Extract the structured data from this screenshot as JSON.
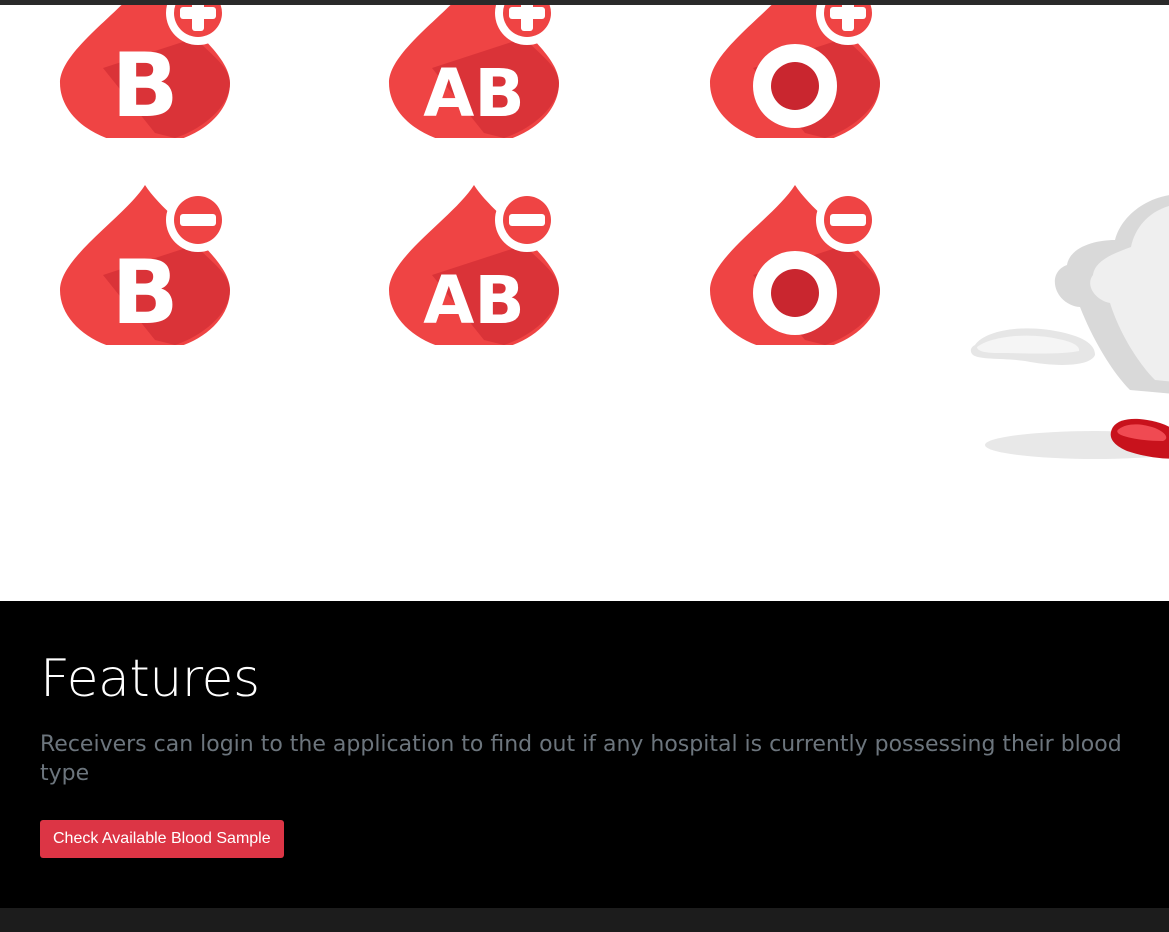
{
  "hero": {
    "blood_types": [
      {
        "letters": "B",
        "sign": "+"
      },
      {
        "letters": "AB",
        "sign": "+"
      },
      {
        "letters": "O",
        "sign": "+"
      },
      {
        "letters": "B",
        "sign": "-"
      },
      {
        "letters": "AB",
        "sign": "-"
      },
      {
        "letters": "O",
        "sign": "-"
      }
    ]
  },
  "features": {
    "title": "Features",
    "description": "Receivers can login to the application to find out if any hospital is currently possessing their blood type",
    "button_label": "Check Available Blood Sample"
  },
  "colors": {
    "drop_red": "#ef4444",
    "drop_shadow": "#c9262f",
    "button_red": "#dc3545",
    "section_bg": "#000000",
    "description_gray": "#6c757d"
  }
}
